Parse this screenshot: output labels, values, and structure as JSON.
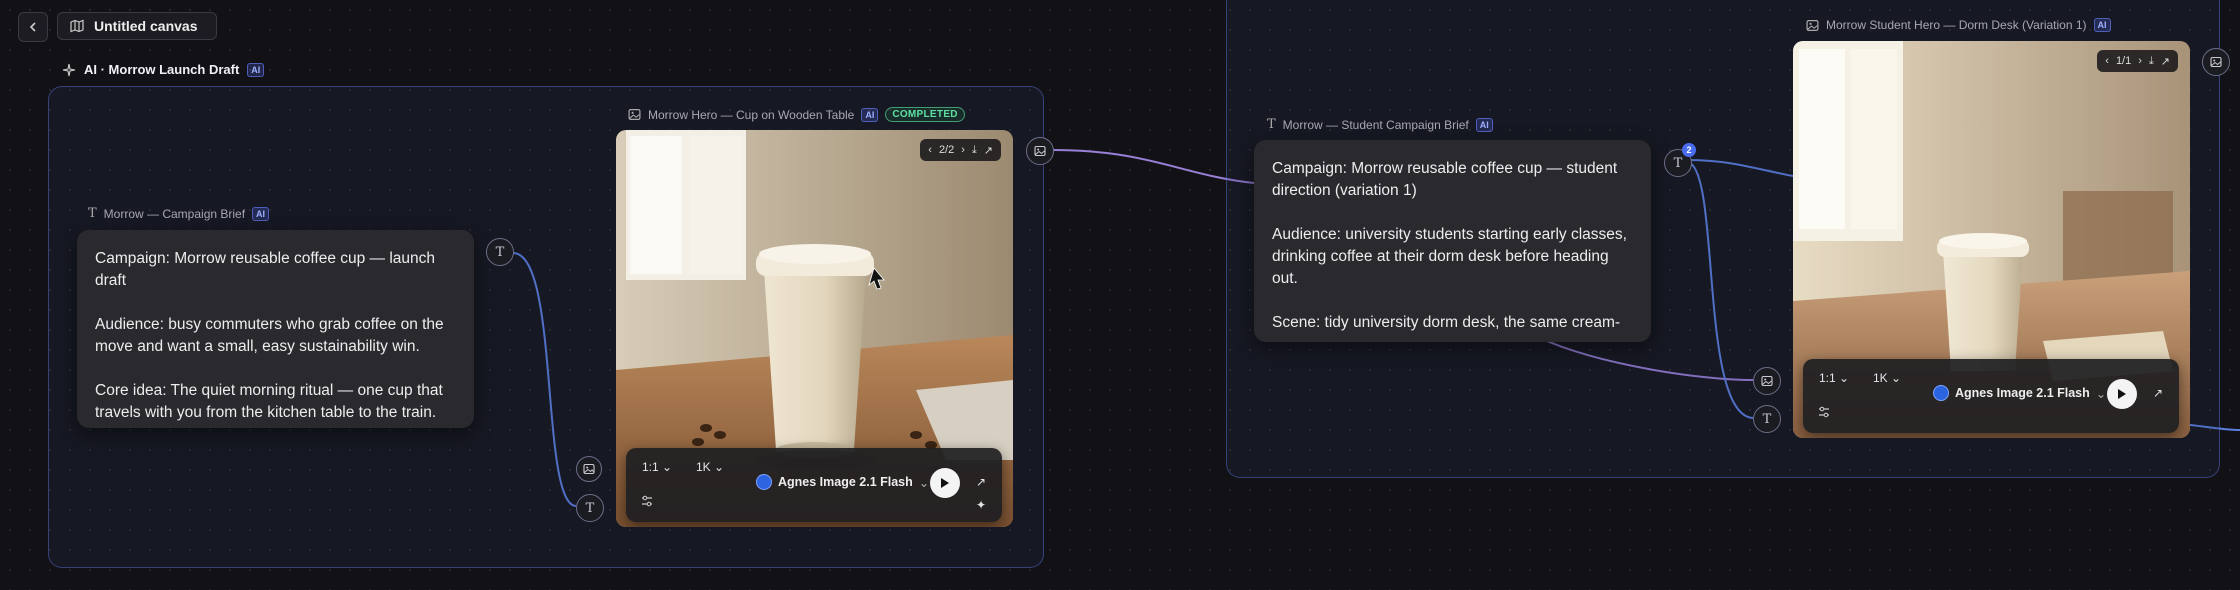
{
  "canvas": {
    "title": "Untitled canvas"
  },
  "group1": {
    "label": "AI · Morrow Launch Draft",
    "ai_tag": "AI"
  },
  "brief1": {
    "title": "Morrow — Campaign Brief",
    "ai_tag": "AI",
    "paragraphs": [
      "Campaign: Morrow reusable coffee cup — launch draft",
      "Audience: busy commuters who grab coffee on the move and want a small, easy sustainability win.",
      "Core idea: The quiet morning ritual — one cup that travels with you from the kitchen table to the train."
    ]
  },
  "image1": {
    "title": "Morrow Hero — Cup on Wooden Table",
    "ai_tag": "AI",
    "status": "COMPLETED",
    "pager": "2/2",
    "aspect": "1:1",
    "resolution": "1K",
    "model": "Agnes Image 2.1 Flash"
  },
  "brief2": {
    "title": "Morrow — Student Campaign Brief",
    "ai_tag": "AI",
    "paragraphs": [
      "Campaign: Morrow reusable coffee cup — student direction (variation 1)",
      "Audience: university students starting early classes, drinking coffee at their dorm desk before heading out.",
      "Scene: tidy university dorm desk, the same cream-"
    ]
  },
  "image2": {
    "title": "Morrow Student Hero — Dorm Desk (Variation 1)",
    "ai_tag": "AI",
    "pager": "1/1",
    "aspect": "1:1",
    "resolution": "1K",
    "model": "Agnes Image 2.1 Flash"
  },
  "ports": {
    "badge_count": "2",
    "text_glyph": "T"
  },
  "colors": {
    "accent": "#5b6cf0",
    "edge_purple": "#9a7fd8",
    "edge_blue": "#5a7fe0",
    "status_green": "#5fe0a0"
  }
}
